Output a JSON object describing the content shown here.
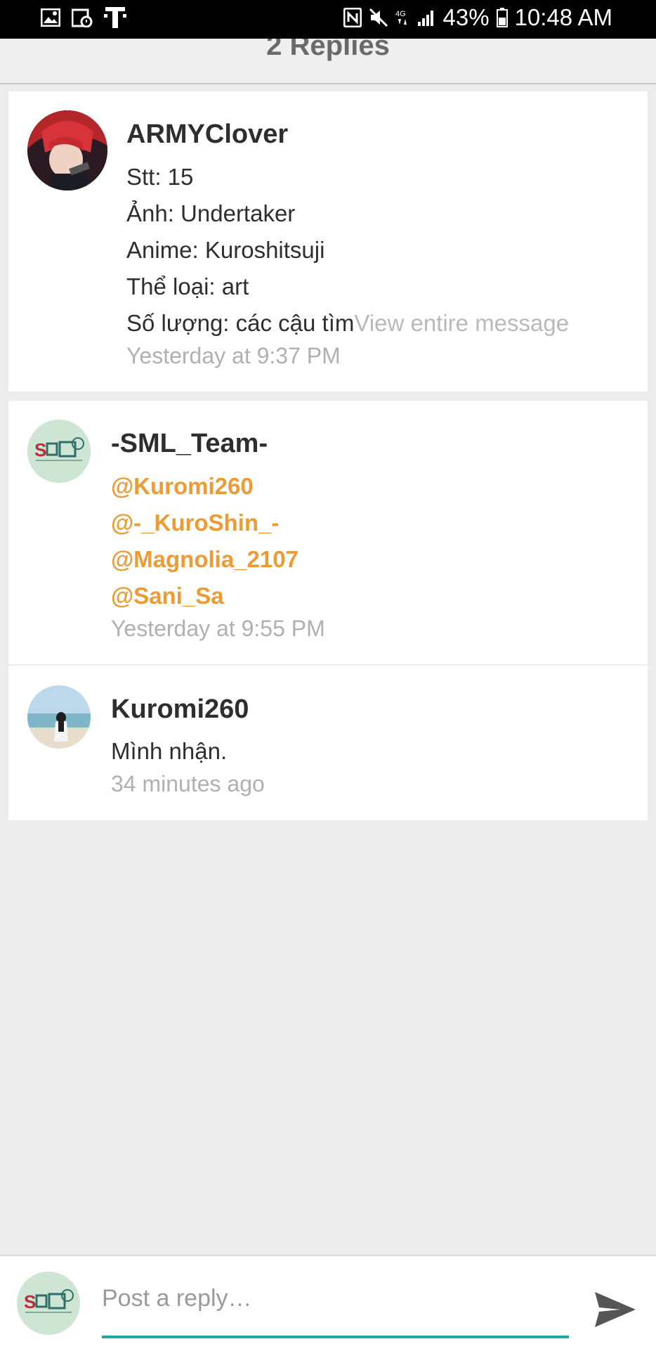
{
  "status_bar": {
    "battery": "43%",
    "time": "10:48 AM",
    "icons": [
      "image-icon",
      "calendar-icon",
      "tmobile-icon",
      "nfc-icon",
      "mute-icon",
      "4g-icon",
      "signal-icon",
      "battery-icon"
    ]
  },
  "header": {
    "title": "2 Replies"
  },
  "comments": [
    {
      "author": "ARMYClover",
      "lines": [
        "Stt: 15",
        "Ảnh: Undertaker",
        "Anime: Kuroshitsuji",
        "Thể loại: art"
      ],
      "last_line": "Số lượng: các cậu tìm",
      "view_more": "View entire message",
      "time": "Yesterday at 9:37 PM"
    },
    {
      "author": "-SML_Team-",
      "mentions": [
        "@Kuromi260",
        "@-_KuroShin_-",
        "@Magnolia_2107",
        "@Sani_Sa"
      ],
      "time": "Yesterday at 9:55 PM"
    },
    {
      "author": "Kuromi260",
      "text": "Mình nhận.",
      "time": "34 minutes ago"
    }
  ],
  "composer": {
    "placeholder": "Post a reply…",
    "accent": "#1fa7a2"
  },
  "colors": {
    "mention": "#ec9b35",
    "timestamp": "#b0b0b0",
    "background": "#ececec"
  }
}
